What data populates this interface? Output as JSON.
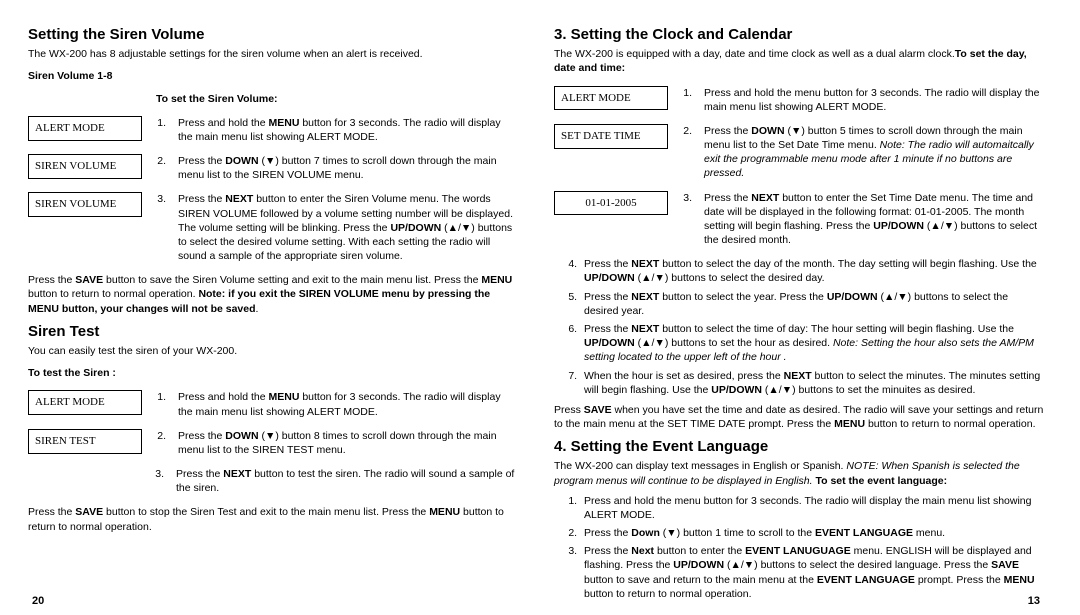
{
  "left": {
    "sirenVolume": {
      "title": "Setting the Siren Volume",
      "intro": "The WX-200 has 8 adjustable settings for the siren volume when an alert is received.",
      "sub1": "Siren Volume 1-8",
      "sub2": "To set the Siren Volume:",
      "lcd1": "ALERT MODE",
      "step1": "Press and hold the MENU button for 3 seconds. The radio will display the main menu list showing ALERT MODE.",
      "lcd2": "SIREN VOLUME",
      "step2": "Press the DOWN (▼) button 7 times to scroll down through the main menu list to the SIREN VOLUME menu.",
      "lcd3": "SIREN VOLUME",
      "step3": "Press the NEXT button to enter the Siren Volume menu. The words SIREN VOLUME  followed by a volume setting number will be displayed. The volume setting will be blinking. Press the UP/DOWN (▲/▼) buttons to select the desired volume setting. With each setting the radio will sound a sample of the appropriate siren volume.",
      "save": "Press the SAVE button to save the Siren Volume setting and exit to the main menu list. Press the MENU button to return to normal operation. Note: if you exit the SIREN VOLUME menu by pressing the MENU button, your changes will not be saved."
    },
    "sirenTest": {
      "title": "Siren Test",
      "intro": "You can easily test the siren of your WX-200.",
      "sub": "To test the Siren :",
      "lcd1": "ALERT MODE",
      "step1": "Press and hold the MENU button for 3 seconds. The radio will display the main menu list showing ALERT MODE.",
      "lcd2": "SIREN TEST",
      "step2": "Press the DOWN (▼) button 8 times to scroll down through the main menu list to the SIREN TEST menu.",
      "step3": "Press the NEXT button to test the siren. The radio will sound a sample of the siren.",
      "save": "Press the SAVE button to stop the Siren Test and exit to the main menu list. Press the MENU button to return to normal operation."
    },
    "pageNum": "20"
  },
  "right": {
    "clock": {
      "title": "3.  Setting  the Clock and Calendar",
      "intro": "The WX-200 is equipped with a day, date and time clock as well as a dual alarm clock.",
      "introBold": "To set the day, date and time:",
      "lcd1": "ALERT MODE",
      "step1": "Press and hold the menu button for 3 seconds. The radio will display the main menu list showing ALERT MODE.",
      "lcd2": "SET DATE TIME",
      "step2a": "Press the DOWN (▼) button 5 times to scroll down through the main menu list to the Set Date Time menu.",
      "step2b": "Note: The radio will automaitcally exit the programmable menu mode after 1 minute if no buttons are pressed.",
      "lcd3": "01-01-2005",
      "step3": "Press the NEXT button to enter the Set Time Date menu. The time and date will be displayed in the following format: 01-01-2005. The month setting will begin flashing. Press the UP/DOWN (▲/▼) buttons to select the desired month.",
      "step4": "Press the NEXT button to select the day of the month. The day setting will begin flashing. Use the UP/DOWN (▲/▼)  buttons to select the desired day.",
      "step5": "Press the NEXT button to select the year. Press the UP/DOWN (▲/▼) buttons to select the desired year.",
      "step6a": "Press the NEXT button to select the time of day: The hour setting will begin flashing. Use the UP/DOWN (▲/▼) buttons to set the hour as desired.",
      "step6b": "Note: Setting the hour also sets the AM/PM setting located to the upper left of the hour .",
      "step7": "When the hour is set as desired, press the NEXT button to select the minutes. The minutes setting will begin flashing. Use the UP/DOWN (▲/▼) buttons to set the minuites as desired.",
      "save": "Press SAVE when you have set the time and date as desired. The radio will save your settings and return to the main menu at the SET TIME DATE prompt. Press the MENU button to return to normal operation."
    },
    "lang": {
      "title": "4.  Setting the Event Language",
      "intro1": "The WX-200 can display text messages in English or Spanish.",
      "intro2": "NOTE: When Spanish is selected the program menus will continue to be displayed in English.",
      "intro3": "To set the event language:",
      "step1": "Press and hold the menu button for 3 seconds. The radio will display the main menu list showing ALERT MODE.",
      "step2": "Press the Down (▼) button 1 time to scroll to the EVENT LANGUAGE menu.",
      "step3": "Press the Next button to enter the EVENT LANUGUAGE menu. ENGLISH will be displayed and flashing. Press the UP/DOWN (▲/▼) buttons to select the desired language. Press the SAVE button to save and return to the main menu at the EVENT LANGUAGE prompt. Press the MENU button to return to normal operation."
    },
    "pageNum": "13"
  }
}
